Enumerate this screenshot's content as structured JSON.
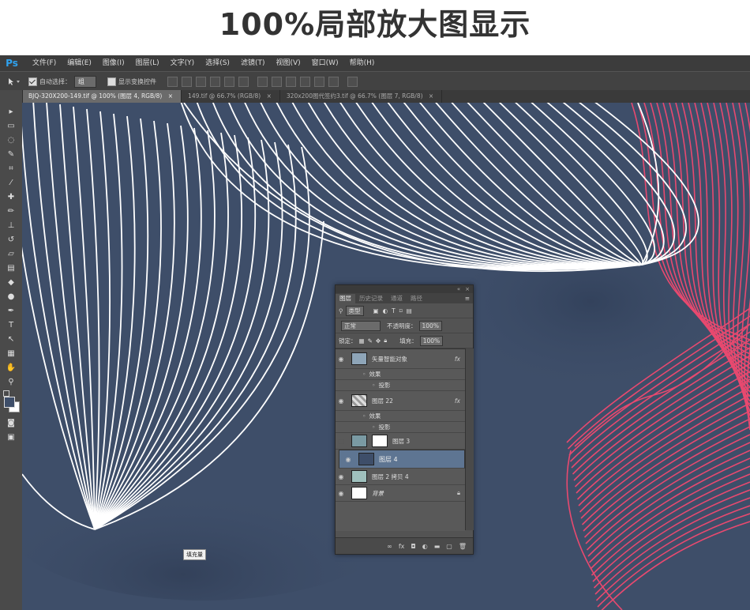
{
  "headline": "100%局部放大图显示",
  "app": {
    "logo": "Ps",
    "menu": [
      "文件(F)",
      "编辑(E)",
      "图像(I)",
      "图层(L)",
      "文字(Y)",
      "选择(S)",
      "滤镜(T)",
      "视图(V)",
      "窗口(W)",
      "帮助(H)"
    ]
  },
  "options": {
    "auto_select_label": "自动选择：",
    "auto_select_value": "组",
    "show_transform_label": "显示变换控件"
  },
  "doc_tabs": [
    {
      "label": "BJQ-320X200-149.tif @ 100% (图层 4, RGB/8)",
      "close": "×"
    },
    {
      "label": "149.tif @ 66.7% (RGB/8)",
      "close": "×"
    },
    {
      "label": "320x200图代签约3.tif @ 66.7% (图层 7, RGB/8)",
      "close": "×"
    }
  ],
  "layers_panel": {
    "tabs": [
      "图层",
      "历史记录",
      "通道",
      "路径"
    ],
    "filter_kind": "类型",
    "blend_mode": "正常",
    "opacity_label": "不透明度：",
    "opacity_value": "100%",
    "lock_label": "锁定：",
    "fill_label": "填充：",
    "fill_value": "100%",
    "layers": [
      {
        "name": "矢量智能对象",
        "fx": "fx",
        "effects_label": "效果",
        "effect": "投影"
      },
      {
        "name": "图层 22",
        "fx": "fx",
        "effects_label": "效果",
        "effect": "投影"
      },
      {
        "name": "图层 3"
      },
      {
        "name": "图层 4"
      },
      {
        "name": "图层 2 拷贝 4"
      },
      {
        "name": "背景"
      }
    ]
  },
  "canvas_tooltip": "填充量",
  "colors": {
    "canvas_bg": "#3e4e69",
    "white_lines": "#ffffff",
    "pink_lines": "#e8496f",
    "selected_layer": "#5e7592"
  }
}
